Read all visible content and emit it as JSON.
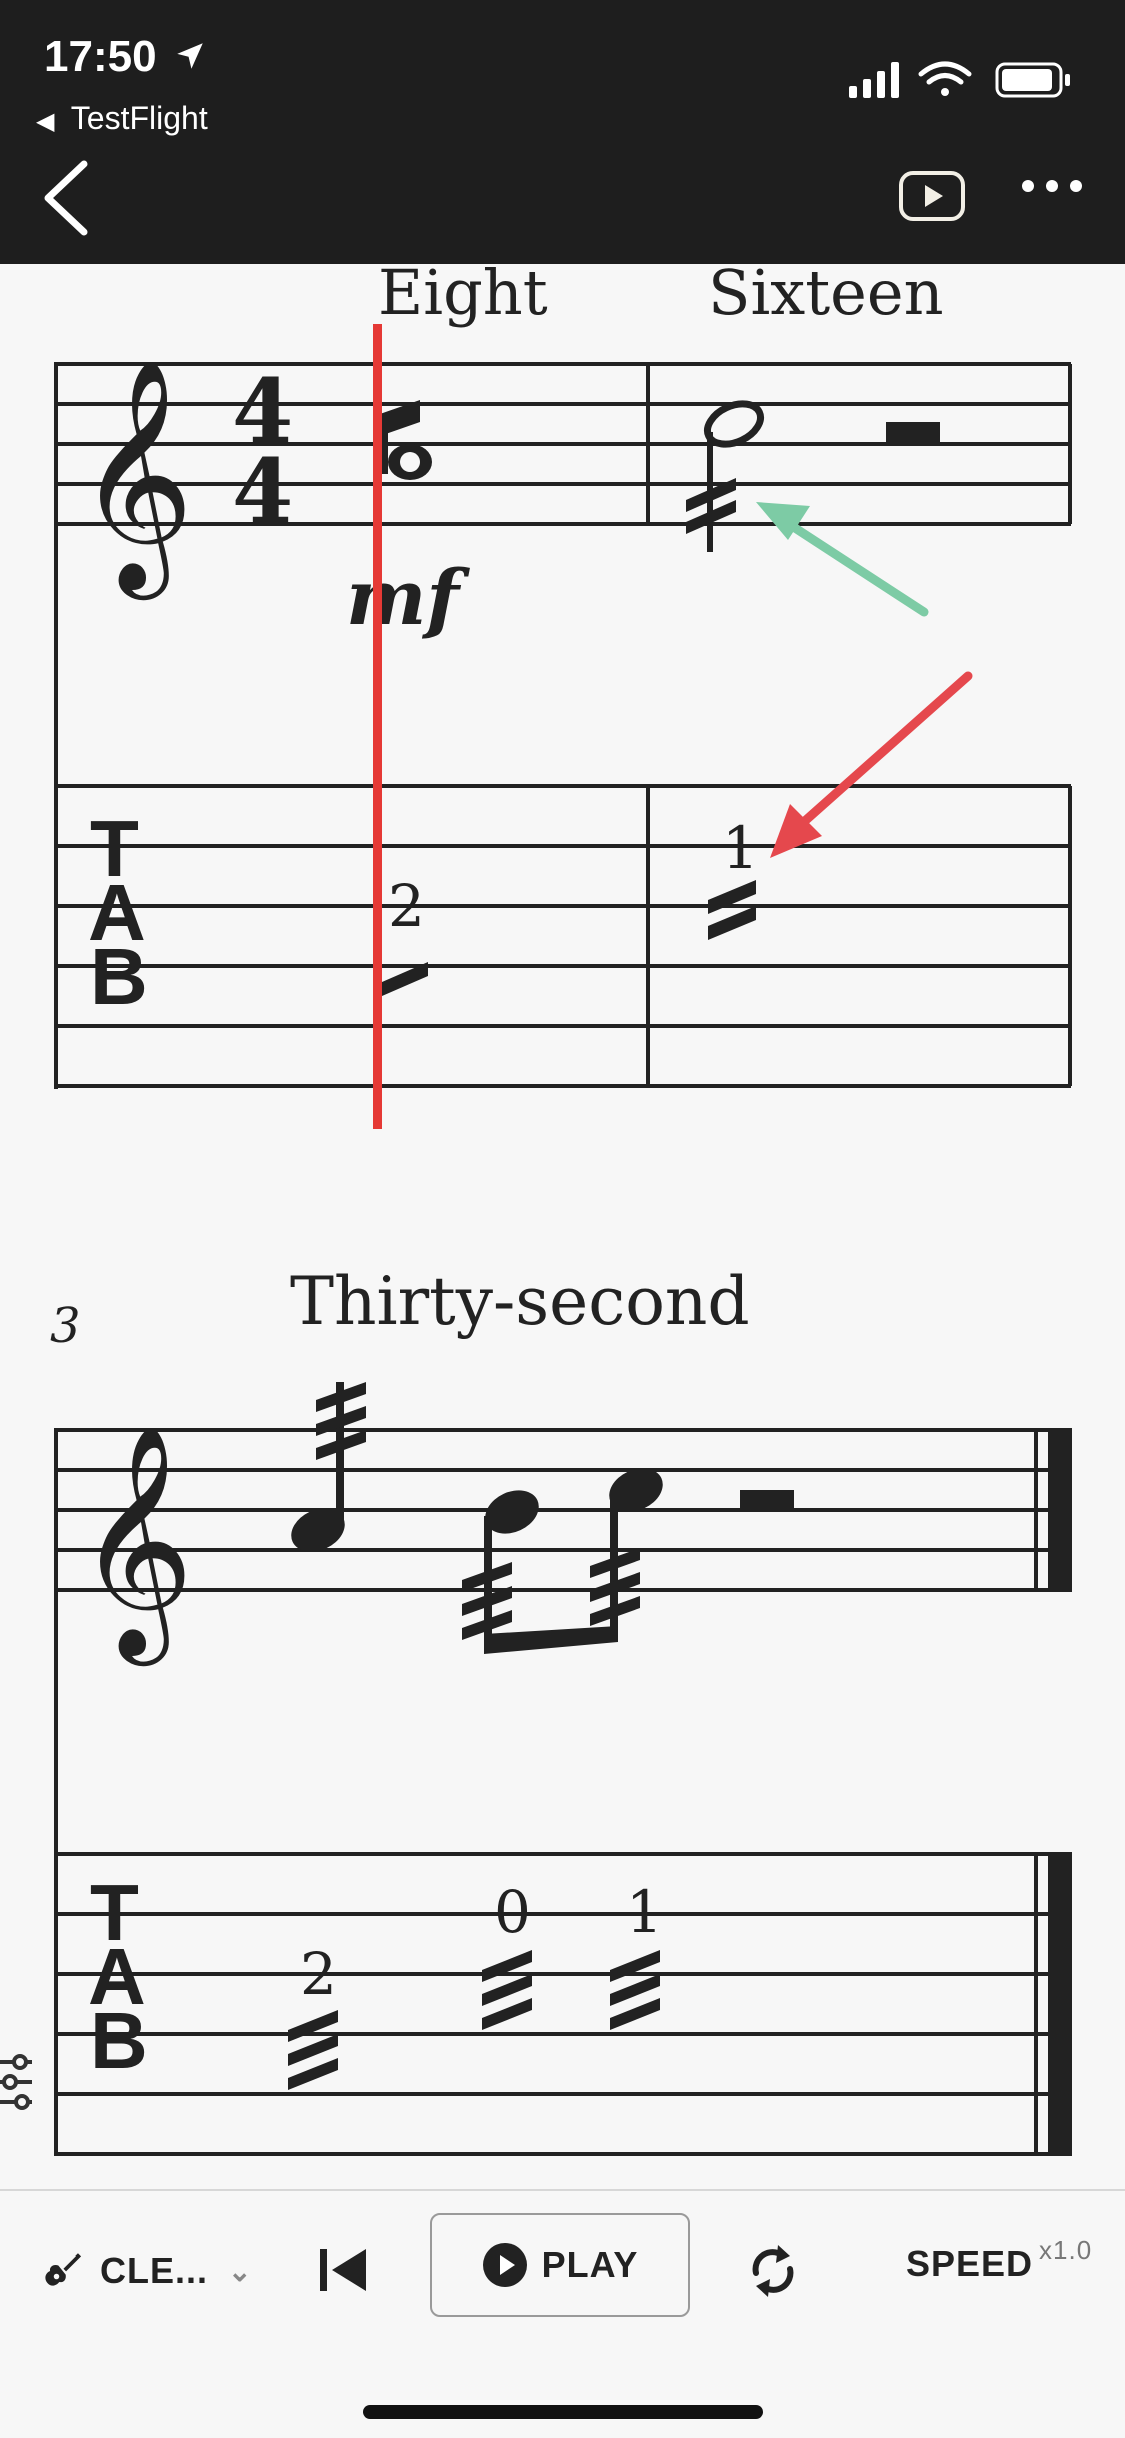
{
  "status_bar": {
    "time": "17:50",
    "back_app_label": "TestFlight"
  },
  "nav": {
    "back_icon": "chevron-left-icon",
    "video_icon": "youtube-icon",
    "more_icon": "more-horizontal-icon"
  },
  "score": {
    "system1": {
      "measure1_label": "Eight",
      "measure2_label": "Sixteen",
      "dynamic": "mf",
      "tab_fret_m1": "2",
      "tab_fret_m2": "1"
    },
    "system2": {
      "measure_number": "3",
      "measure_label": "Thirty-second",
      "tab_frets": [
        "2",
        "0",
        "1"
      ]
    },
    "tab_letters": [
      "T",
      "A",
      "B"
    ],
    "annotations": {
      "green_arrow_color": "#7dcba5",
      "red_arrow_color": "#e5484d",
      "cursor_color": "#e53935"
    }
  },
  "bottom_bar": {
    "tone_label": "CLE...",
    "play_label": "PLAY",
    "speed_label": "SPEED",
    "speed_value": "x1.0",
    "icons": {
      "tone": "guitar-icon",
      "tone_dropdown": "chevron-down-icon",
      "prev": "skip-back-icon",
      "play": "play-circle-icon",
      "loop": "repeat-icon",
      "mixer": "sliders-icon"
    }
  }
}
